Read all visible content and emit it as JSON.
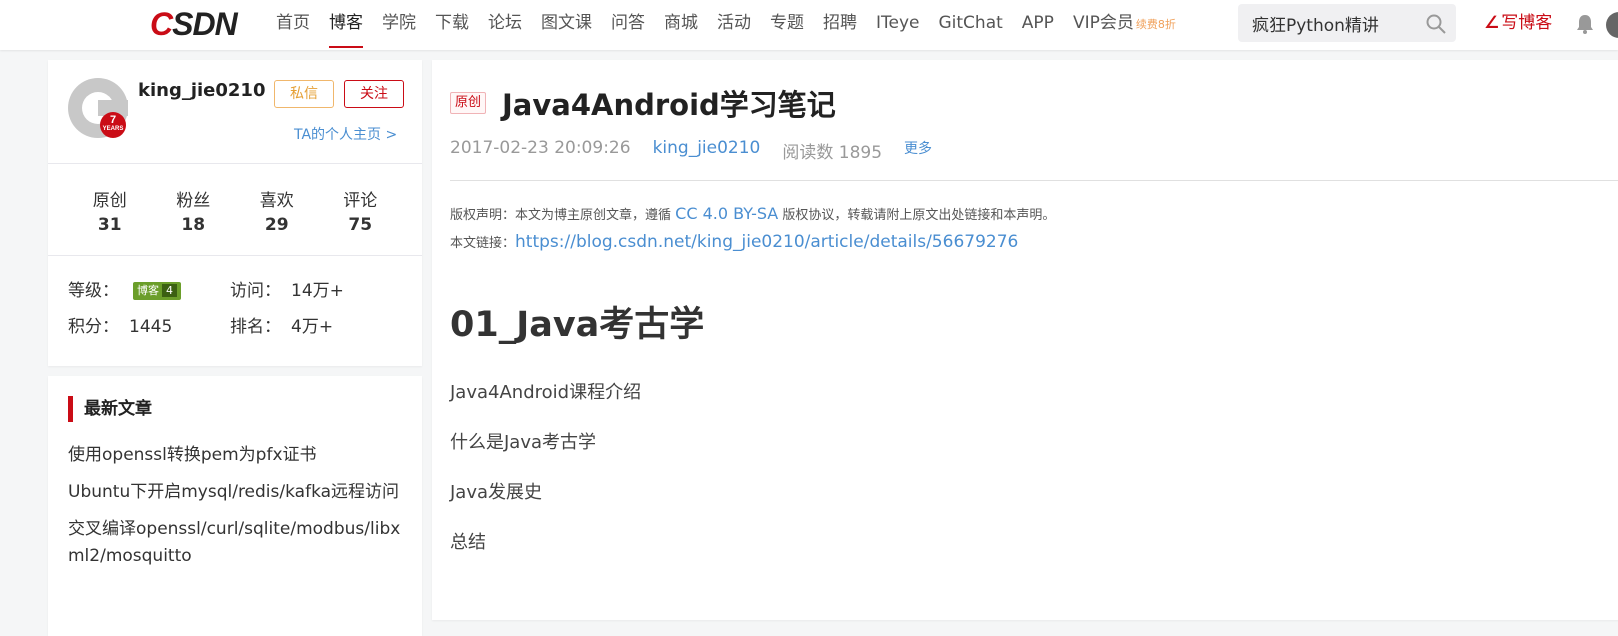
{
  "header": {
    "logo": {
      "c": "C",
      "rest": "SDN"
    },
    "nav": [
      "首页",
      "博客",
      "学院",
      "下载",
      "论坛",
      "图文课",
      "问答",
      "商城",
      "活动",
      "专题",
      "招聘",
      "ITeye",
      "GitChat",
      "APP",
      "VIP会员"
    ],
    "vip_badge": "续费8折",
    "active_nav": "博客",
    "search_value": "疯狂Python精讲",
    "write_label": "写博客"
  },
  "profile": {
    "username": "king_jie0210",
    "years": "7",
    "years_caption": "YEARS",
    "message_btn": "私信",
    "follow_btn": "关注",
    "homepage_link": "TA的个人主页 >",
    "stats": [
      {
        "label": "原创",
        "value": "31"
      },
      {
        "label": "粉丝",
        "value": "18"
      },
      {
        "label": "喜欢",
        "value": "29"
      },
      {
        "label": "评论",
        "value": "75"
      }
    ],
    "level_label": "等级：",
    "level_badge": "博客",
    "level_num": "4",
    "visits_label": "访问：",
    "visits_value": "14万+",
    "points_label": "积分：",
    "points_value": "1445",
    "rank_label": "排名：",
    "rank_value": "4万+"
  },
  "recent": {
    "title": "最新文章",
    "items": [
      "使用openssl转换pem为pfx证书",
      "Ubuntu下开启mysql/redis/kafka远程访问",
      "交叉编译openssl/curl/sqlite/modbus/libxml2/mosquitto"
    ]
  },
  "article": {
    "tag": "原创",
    "title": "Java4Android学习笔记",
    "date": "2017-02-23 20:09:26",
    "author": "king_jie0210",
    "reads": "阅读数 1895",
    "more": "更多",
    "copyright_prefix": "版权声明：本文为博主原创文章，遵循 ",
    "license": "CC 4.0 BY-SA",
    "copyright_suffix": " 版权协议，转载请附上原文出处链接和本声明。",
    "link_label": "本文链接：",
    "link_url": "https://blog.csdn.net/king_jie0210/article/details/56679276",
    "heading": "01_Java考古学",
    "paragraphs": [
      "Java4Android课程介绍",
      "什么是Java考古学",
      "Java发展史",
      "总结"
    ]
  },
  "colors": {
    "brand_red": "#ca0c16",
    "link_blue": "#4a8ed1"
  },
  "icons": [
    "search-icon",
    "bell-icon",
    "pen-icon"
  ]
}
